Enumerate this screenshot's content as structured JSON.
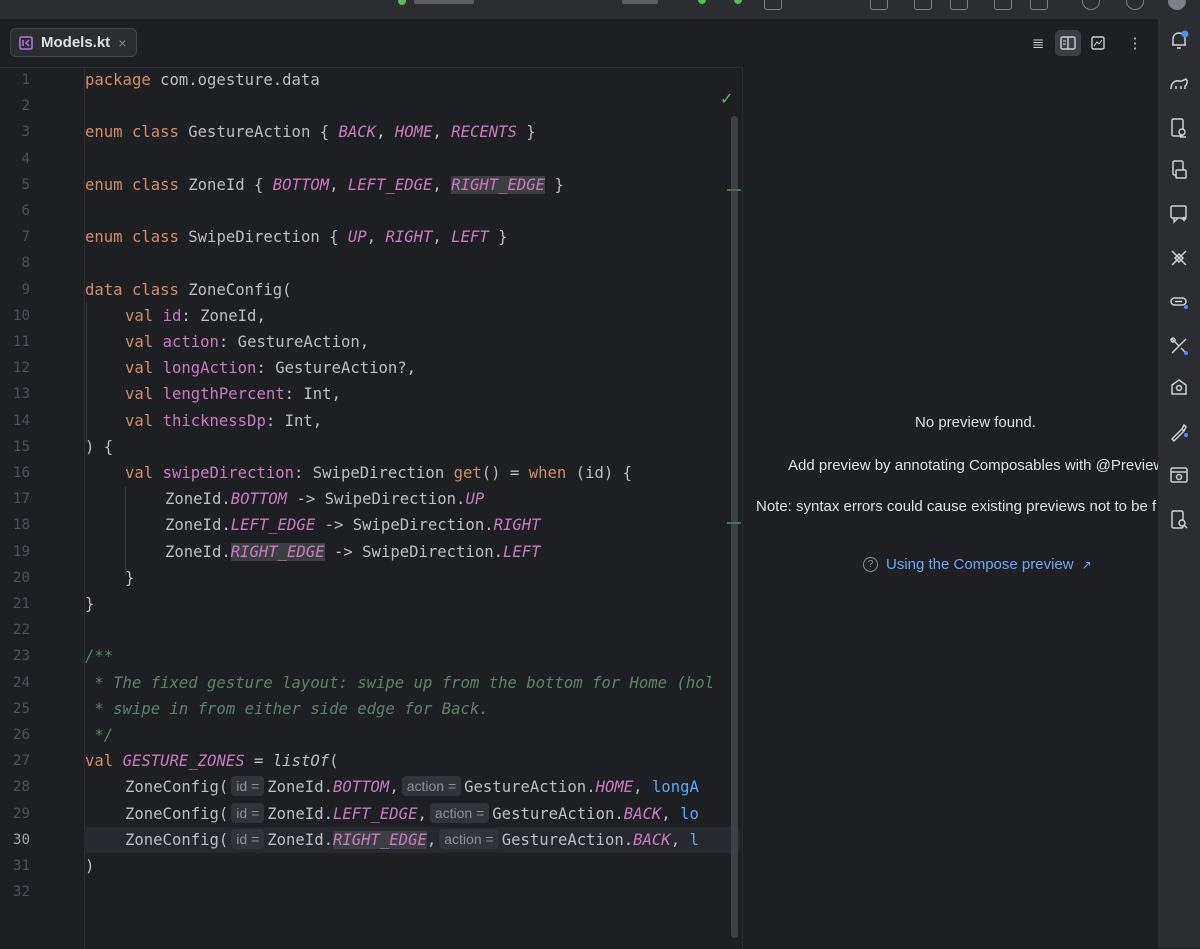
{
  "editor": {
    "tab": {
      "name": "Models.kt",
      "close": "×"
    }
  },
  "gutter": {
    "lines": [
      "1",
      "2",
      "3",
      "4",
      "5",
      "6",
      "7",
      "8",
      "9",
      "10",
      "11",
      "12",
      "13",
      "14",
      "15",
      "16",
      "17",
      "18",
      "19",
      "20",
      "21",
      "22",
      "23",
      "24",
      "25",
      "26",
      "27",
      "28",
      "29",
      "30",
      "31",
      "32"
    ],
    "current_line": "30"
  },
  "code": {
    "package_kw": "package",
    "package_name": " com.ogesture.data",
    "enum_class": "enum class",
    "gesture_action": " GestureAction { ",
    "back": "BACK",
    "home": "HOME",
    "recents": "RECENTS",
    "zone_id": " ZoneId { ",
    "bottom": "BOTTOM",
    "left_edge": "LEFT_EDGE",
    "right_edge": "RIGHT_EDGE",
    "swipe_direction": " SwipeDirection { ",
    "up": "UP",
    "right": "RIGHT",
    "left": "LEFT",
    "comma": ", ",
    "close_brace": " }",
    "data_class": "data class",
    "zone_config": " ZoneConfig(",
    "val": "val",
    "id": "id",
    "id_type": ": ZoneId,",
    "action": "action",
    "action_type": ": GestureAction,",
    "long_action": "longAction",
    "long_action_type": ": GestureAction?,",
    "length_percent": "lengthPercent",
    "int_type": ": Int,",
    "thickness_dp": "thicknessDp",
    "class_body_open": ") {",
    "swipe_direction_prop": "swipeDirection",
    "swipe_direction_type": ": SwipeDirection ",
    "get": "get",
    "get_tail": "() = ",
    "when": "when",
    "when_tail": " (id) {",
    "zoneid_dot": "ZoneId.",
    "arrow_dir": " -> SwipeDirection.",
    "inner_close": "}",
    "outer_close": "}",
    "doc_open": "/**",
    "doc_line1": " * The fixed gesture layout: swipe up from the bottom for Home (hol",
    "doc_line2": " * swipe in from either side edge for Back.",
    "doc_close": " */",
    "gesture_zones": "GESTURE_ZONES",
    "assign": " = ",
    "list_of": "listOf",
    "open_paren": "(",
    "zone_config_call": "ZoneConfig(",
    "hint_id": "id =",
    "hint_action": "action =",
    "zoneid_call": "ZoneId.",
    "gesture_action_call": "GestureAction.",
    "trail_comma": ",",
    "long_a": "longA",
    "lo": "lo",
    "l": "l",
    "close_paren": ")"
  },
  "preview": {
    "no_preview": "No preview found.",
    "add_preview": "Add preview by annotating Composables with @Preview",
    "note": "Note: syntax errors could cause existing previews not to be f",
    "help_link": "Using the Compose preview",
    "help_icon": "question-icon",
    "link_arrow": "↗"
  },
  "colors": {
    "background": "#1e1f22",
    "keyword": "#cf8e6d",
    "constant": "#c77dbb",
    "comment": "#5f826b",
    "link": "#6aa7f8",
    "check": "#5fb865"
  },
  "icons": {
    "toolbar": [
      "reader-mode-icon",
      "split-view-icon",
      "preview-icon",
      "more-icon"
    ],
    "right_strip": [
      "notifications-icon",
      "gradle-icon",
      "device-manager-icon",
      "running-devices-icon",
      "ai-assistant-icon",
      "app-quality-icon",
      "device-mirroring-icon",
      "build-variants-icon",
      "layout-inspector-icon",
      "resource-manager-icon",
      "emulator-icon",
      "inspection-icon"
    ]
  }
}
